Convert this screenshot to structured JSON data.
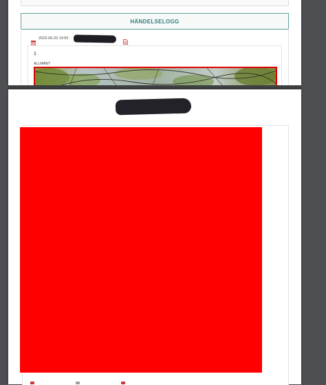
{
  "log_section": {
    "title": "HÄNDELSELOGG",
    "entry": {
      "date": "2023-06-20 10:55",
      "author": "",
      "number": "1",
      "category": "ALLMÄNT"
    }
  },
  "page2": {
    "author": ""
  },
  "colors": {
    "viewer_background": "#4d4f52",
    "section_title": "#2f7f7b",
    "section_border": "#5f9e9c",
    "image_border": "#e00000",
    "red_block": "#ff0000",
    "redaction": "#1e1e24",
    "icon_red": "#c83a3a"
  },
  "icons": {
    "date": "calendar-icon",
    "attachment": "document-icon"
  }
}
